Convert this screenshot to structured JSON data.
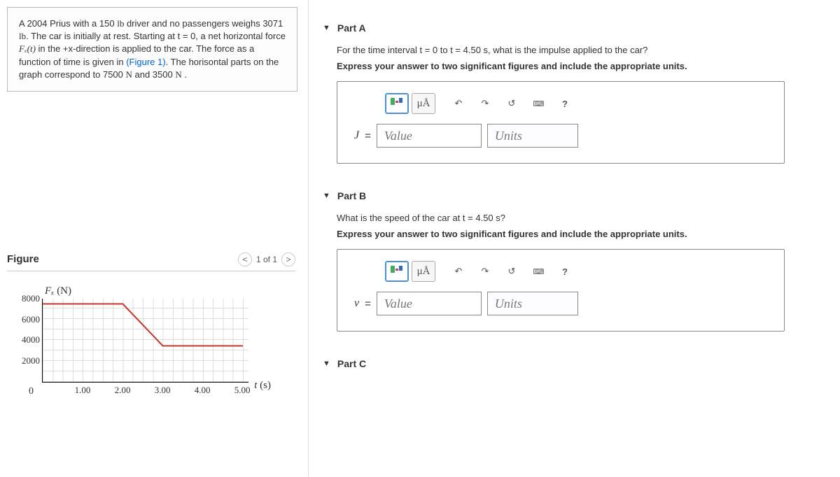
{
  "problem": {
    "text_1": "A 2004 Prius with a 150 ",
    "lb1": "lb",
    "text_2": " driver and no passengers weighs 3071 ",
    "lb2": "lb",
    "text_3": ". The car is initially at rest. Starting at t = 0, a net horizontal force ",
    "fx": "Fₓ(t)",
    "text_4": " in the +x-direction is applied to the car. The force as a function of time is given in ",
    "figlink": "(Figure 1)",
    "text_5": ". The horisontal parts on the graph correspond to 7500 ",
    "n1": "N",
    "text_6": " and 3500 ",
    "n2": "N",
    "text_7": " ."
  },
  "figure": {
    "title": "Figure",
    "pager": "1 of 1",
    "ylabel_var": "Fₓ",
    "ylabel_unit": " (N)",
    "xlabel_var": "t",
    "xlabel_unit": " (s)",
    "yticks": [
      "8000",
      "6000",
      "4000",
      "2000"
    ],
    "xticks": [
      "1.00",
      "2.00",
      "3.00",
      "4.00",
      "5.00"
    ],
    "zero": "0"
  },
  "parts": {
    "a": {
      "title": "Part A",
      "question": "For the time interval t = 0 to t = 4.50 s, what is the impulse applied to the car?",
      "instruction": "Express your answer to two significant figures and include the appropriate units.",
      "var": "J",
      "value_ph": "Value",
      "units_ph": "Units"
    },
    "b": {
      "title": "Part B",
      "question": "What is the speed of the car at t = 4.50 s?",
      "instruction": "Express your answer to two significant figures and include the appropriate units.",
      "var": "v",
      "value_ph": "Value",
      "units_ph": "Units"
    },
    "c": {
      "title": "Part C"
    }
  },
  "toolbar": {
    "mu_a": "μÅ",
    "help": "?"
  },
  "chart_data": {
    "type": "line",
    "xlabel": "t (s)",
    "ylabel": "Fx (N)",
    "xlim": [
      0,
      5.0
    ],
    "ylim": [
      0,
      8000
    ],
    "series": [
      {
        "name": "Fx(t)",
        "points": [
          {
            "t": 0.0,
            "F": 7500
          },
          {
            "t": 2.0,
            "F": 7500
          },
          {
            "t": 3.0,
            "F": 3500
          },
          {
            "t": 5.0,
            "F": 3500
          }
        ]
      }
    ],
    "notes": "Horizontal segments at 7500 N (0–2 s) and 3500 N (3–5 s), linear ramp 2–3 s."
  }
}
